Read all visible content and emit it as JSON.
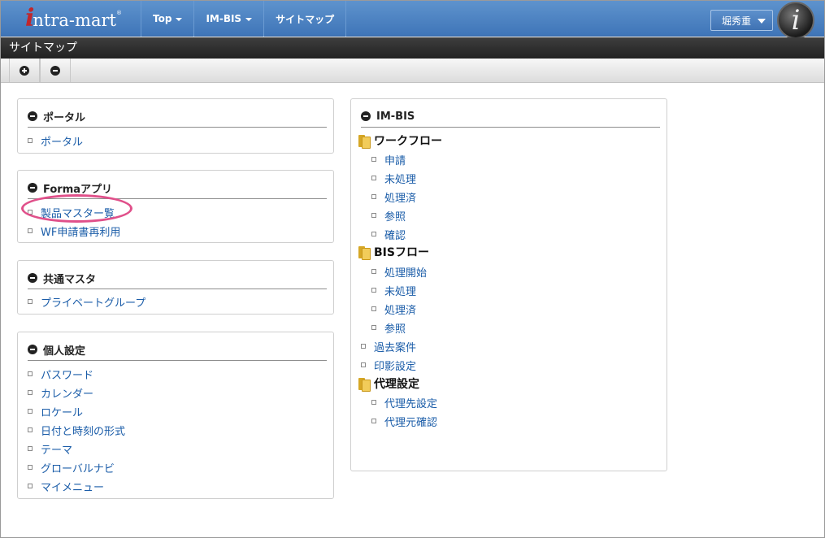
{
  "brand": {
    "name_i": "i",
    "name_rest": "ntra-mart",
    "registered": "®"
  },
  "nav": [
    {
      "label": "Top",
      "dropdown": true
    },
    {
      "label": "IM-BIS",
      "dropdown": true
    },
    {
      "label": "サイトマップ",
      "dropdown": false
    }
  ],
  "user": {
    "name": "堀秀重",
    "logo_letter": "i"
  },
  "page": {
    "title": "サイトマップ"
  },
  "toolbar": {
    "expand_icon": "plus-circle-icon",
    "collapse_icon": "minus-circle-icon"
  },
  "panels": {
    "portal": {
      "title": "ポータル",
      "items": [
        "ポータル"
      ]
    },
    "forma": {
      "title": "Formaアプリ",
      "items": [
        "製品マスター覧",
        "WF申請書再利用"
      ]
    },
    "common": {
      "title": "共通マスタ",
      "items": [
        "プライベートグループ"
      ]
    },
    "personal": {
      "title": "個人設定",
      "items": [
        "パスワード",
        "カレンダー",
        "ロケール",
        "日付と時刻の形式",
        "テーマ",
        "グローバルナビ",
        "マイメニュー"
      ]
    },
    "imbis": {
      "title": "IM-BIS",
      "workflow": {
        "label": "ワークフロー",
        "items": [
          "申請",
          "未処理",
          "処理済",
          "参照",
          "確認"
        ]
      },
      "bisflow": {
        "label": "BISフロー",
        "items": [
          "処理開始",
          "未処理",
          "処理済",
          "参照"
        ]
      },
      "links": [
        "過去案件",
        "印影設定"
      ],
      "proxy": {
        "label": "代理設定",
        "items": [
          "代理先設定",
          "代理元確認"
        ]
      }
    }
  },
  "colors": {
    "nav_blue": "#4a80c2",
    "link": "#1a5ca8",
    "highlight": "#e0508a",
    "folder": "#f2cc5a"
  }
}
